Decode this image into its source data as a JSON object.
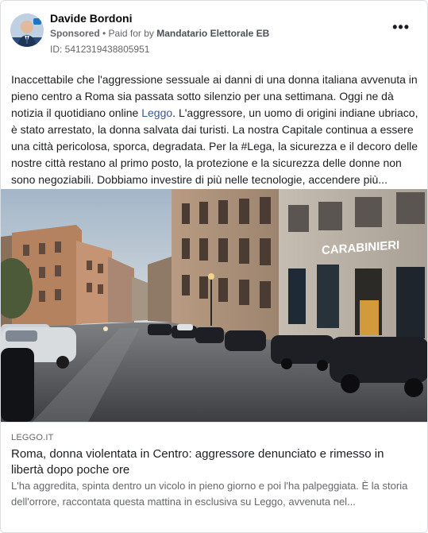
{
  "post": {
    "author": "Davide Bordoni",
    "sponsored": "Sponsored",
    "paid_for_prefix": " • Paid for by ",
    "paid_for_by": "Mandatario Elettorale EB",
    "ad_id": "ID: 5412319438805951",
    "more_icon": "•••",
    "text_part1": "Inaccettabile che l'aggressione sessuale ai danni di una donna italiana avvenuta in pieno centro a Roma sia passata sotto silenzio per una settimana. Oggi ne dà notizia il quotidiano online ",
    "text_link": "Leggo",
    "text_part2": ". L'aggressore, un uomo di origini indiane ubriaco, è stato arrestato, la donna salvata dai turisti. La nostra Capitale continua a essere una città pericolosa, sporca, degradata. Per la #Lega, la sicurezza e il decoro delle nostre città restano al primo posto, la protezione e la sicurezza delle donne non sono negoziabili. Dobbiamo investire di più nelle tecnologie, accendere più..."
  },
  "photo": {
    "sign_text": "CARABINIERI"
  },
  "link_preview": {
    "domain": "LEGGO.IT",
    "headline": "Roma, donna violentata in Centro: aggressore denunciato e rimesso in libertà dopo poche ore",
    "description": "L'ha aggredita, spinta dentro un vicolo in pieno giorno e poi l'ha palpeggiata. È la storia dell'orrore, raccontata questa mattina in esclusiva su Leggo, avvenuta nel..."
  }
}
